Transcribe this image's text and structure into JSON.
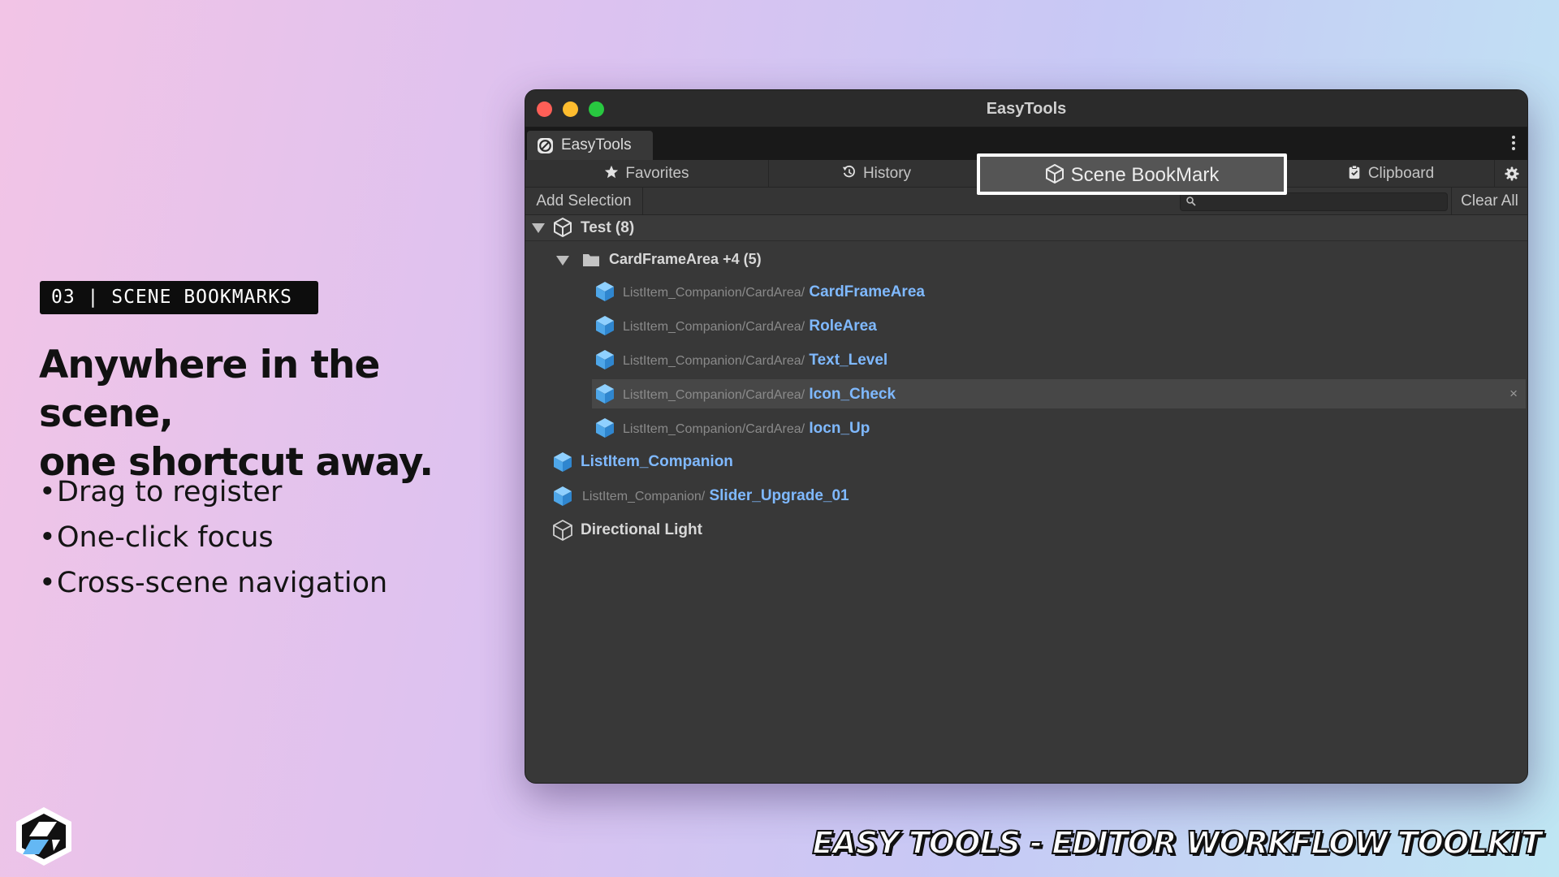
{
  "promo": {
    "tag": "03 | SCENE BOOKMARKS",
    "headline_line1": "Anywhere in the scene,",
    "headline_line2": "one shortcut away.",
    "bullets": [
      "Drag to register",
      "One-click focus",
      "Cross-scene navigation"
    ],
    "bullet_glyph": "•",
    "footer_title": "EASY TOOLS - EDITOR WORKFLOW TOOLKIT"
  },
  "window": {
    "title": "EasyTools",
    "doc_tab": "EasyTools",
    "tabs": {
      "favorites": "Favorites",
      "history": "History",
      "scene_bookmark": "Scene BookMark",
      "clipboard": "Clipboard"
    },
    "actions": {
      "add_selection": "Add Selection",
      "clear_all": "Clear All",
      "search_value": ""
    },
    "tree": {
      "root": {
        "label": "Test (8)"
      },
      "group": {
        "label": "CardFrameArea +4 (5)"
      },
      "group_items": [
        {
          "path": "ListItem_Companion/CardArea/",
          "name": "CardFrameArea"
        },
        {
          "path": "ListItem_Companion/CardArea/",
          "name": "RoleArea"
        },
        {
          "path": "ListItem_Companion/CardArea/",
          "name": "Text_Level"
        },
        {
          "path": "ListItem_Companion/CardArea/",
          "name": "Icon_Check",
          "selected": true,
          "remove": "×"
        },
        {
          "path": "ListItem_Companion/CardArea/",
          "name": "Iocn_Up"
        }
      ],
      "items": [
        {
          "path": "",
          "name": "ListItem_Companion"
        },
        {
          "path": "ListItem_Companion/",
          "name": "Slider_Upgrade_01"
        },
        {
          "path": "",
          "name": "Directional Light"
        }
      ]
    }
  },
  "colors": {
    "link_blue": "#7fb9ff",
    "prefab_blue": "#5fb0f0",
    "panel_bg": "#383838",
    "highlight_border": "#ffffff"
  },
  "icons": [
    "star-icon",
    "history-icon",
    "unity-icon",
    "clipboard-icon",
    "gear-icon",
    "search-icon",
    "folder-icon",
    "prefab-cube-icon",
    "gameobject-cube-icon",
    "close-icon",
    "more-vert-icon"
  ]
}
